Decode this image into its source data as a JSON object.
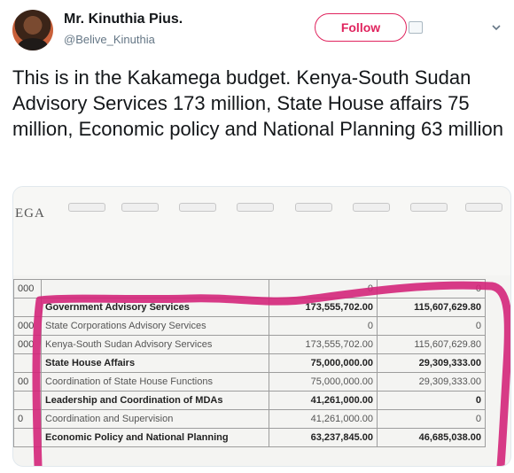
{
  "author": {
    "name": "Mr. Kinuthia Pius.",
    "handle": "@Belive_Kinuthia"
  },
  "follow_label": "Follow",
  "tweet_text": "This is in the Kakamega budget. Kenya-South Sudan Advisory Services 173 million, State House affairs 75 million, Economic policy and National Planning 63 million",
  "document": {
    "header_fragment": "EGA",
    "rows": [
      {
        "code": "000",
        "item": "",
        "amount_a": "0",
        "amount_b": "0",
        "bold": false
      },
      {
        "code": "",
        "item": "Government Advisory Services",
        "amount_a": "173,555,702.00",
        "amount_b": "115,607,629.80",
        "bold": true
      },
      {
        "code": "000",
        "item": "State Corporations Advisory Services",
        "amount_a": "0",
        "amount_b": "0",
        "bold": false
      },
      {
        "code": "000",
        "item": "Kenya-South Sudan Advisory Services",
        "amount_a": "173,555,702.00",
        "amount_b": "115,607,629.80",
        "bold": false
      },
      {
        "code": "",
        "item": "State House Affairs",
        "amount_a": "75,000,000.00",
        "amount_b": "29,309,333.00",
        "bold": true
      },
      {
        "code": "00",
        "item": "Coordination of State House Functions",
        "amount_a": "75,000,000.00",
        "amount_b": "29,309,333.00",
        "bold": false
      },
      {
        "code": "",
        "item": "Leadership and Coordination of MDAs",
        "amount_a": "41,261,000.00",
        "amount_b": "0",
        "bold": true
      },
      {
        "code": "0",
        "item": "Coordination and Supervision",
        "amount_a": "41,261,000.00",
        "amount_b": "0",
        "bold": false
      },
      {
        "code": "",
        "item": "Economic Policy and National Planning",
        "amount_a": "63,237,845.00",
        "amount_b": "46,685,038.00",
        "bold": true
      }
    ]
  },
  "colors": {
    "accent": "#e0245e",
    "marker": "#d4267a",
    "handle_gray": "#657786"
  },
  "icons": [
    "avatar",
    "follow-settings-icon",
    "chevron-down-icon"
  ]
}
